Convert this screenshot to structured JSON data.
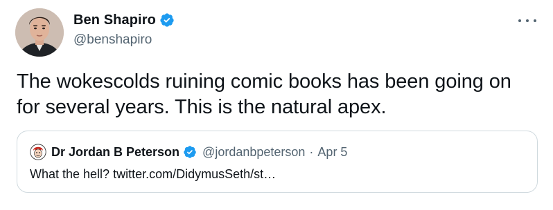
{
  "tweet": {
    "author": {
      "display_name": "Ben Shapiro",
      "handle": "@benshapiro",
      "verified": true,
      "avatar_icon": "avatar-photo"
    },
    "more_icon": "more-options-icon",
    "text": "The wokescolds ruining comic books has been going on for several years. This is the natural apex.",
    "quoted_tweet": {
      "author": {
        "display_name": "Dr Jordan B Peterson",
        "handle": "@jordanbpeterson",
        "verified": true,
        "avatar_icon": "avatar-cartoon"
      },
      "separator": "·",
      "date": "Apr 5",
      "text": "What the hell? twitter.com/DidymusSeth/st…"
    }
  },
  "colors": {
    "text_primary": "#0f1419",
    "text_secondary": "#536471",
    "verified_blue": "#1d9bf0",
    "border": "#cfd9de"
  }
}
